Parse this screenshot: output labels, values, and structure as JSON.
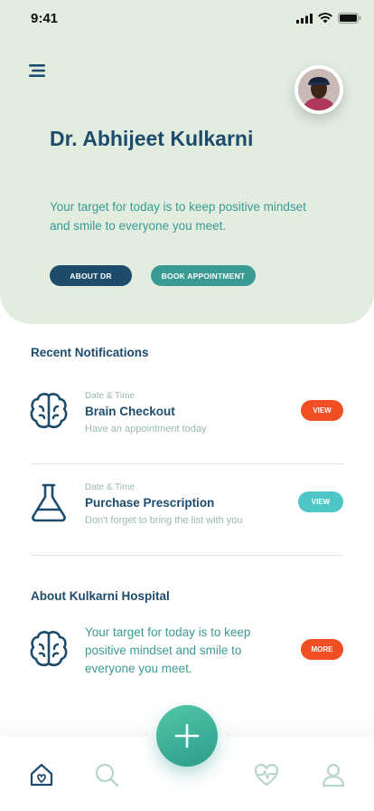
{
  "status_bar": {
    "time": "9:41",
    "icons": [
      "signal-icon",
      "wifi-icon",
      "battery-icon"
    ]
  },
  "header": {
    "menu_icon": "menu-icon",
    "doctor_name": "Dr. Abhijeet Kulkarni",
    "tagline": "Your target for today is to keep positive mindset and smile to everyone you meet.",
    "about_button": "ABOUT DR",
    "book_button": "BOOK APPOINTMENT"
  },
  "notifications": {
    "title": "Recent Notifications",
    "items": [
      {
        "icon": "brain-icon",
        "meta": "Date & Time",
        "title": "Brain Checkout",
        "subtitle": "Have an appointment today",
        "action": "VIEW",
        "action_color": "#f04e23"
      },
      {
        "icon": "flask-icon",
        "meta": "Date & Time",
        "title": "Purchase Prescription",
        "subtitle": "Don't forget to bring the list with you",
        "action": "VIEW",
        "action_color": "#4ec6c8"
      }
    ]
  },
  "about": {
    "title": "About Kulkarni Hospital",
    "icon": "brain-icon",
    "text": "Your target for today is to keep positive mindset and smile to everyone you meet.",
    "action": "MORE"
  },
  "bottom_nav": {
    "items": [
      "home-icon",
      "search-icon",
      "heart-pulse-icon",
      "profile-icon"
    ],
    "fab_icon": "plus-icon"
  },
  "colors": {
    "navy": "#1c4b6c",
    "teal": "#3a9a94",
    "orange": "#f04e23",
    "light_teal": "#4ec6c8",
    "hero_bg": "#e2ede0"
  }
}
